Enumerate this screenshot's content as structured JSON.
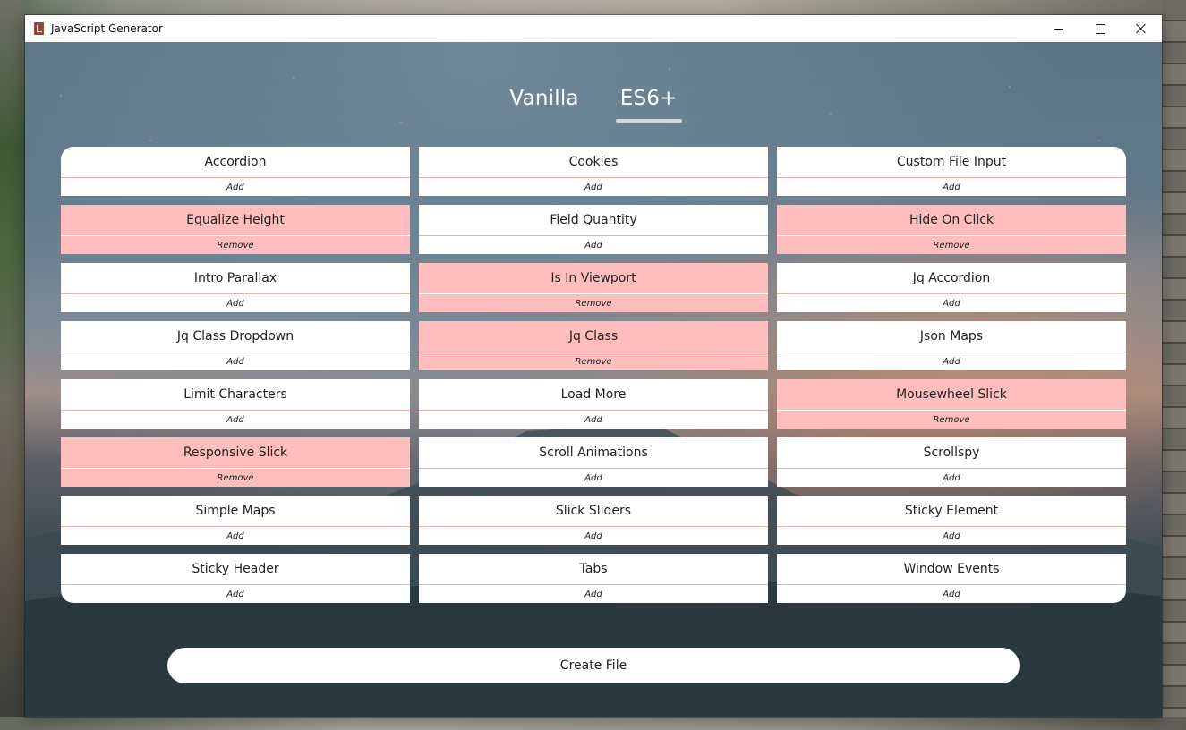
{
  "window": {
    "title": "JavaScript Generator"
  },
  "tabs": [
    {
      "label": "Vanilla",
      "active": false
    },
    {
      "label": "ES6+",
      "active": true
    }
  ],
  "modules": [
    {
      "name": "Accordion",
      "action": "Add",
      "selected": false
    },
    {
      "name": "Cookies",
      "action": "Add",
      "selected": false
    },
    {
      "name": "Custom File Input",
      "action": "Add",
      "selected": false
    },
    {
      "name": "Equalize Height",
      "action": "Remove",
      "selected": true
    },
    {
      "name": "Field Quantity",
      "action": "Add",
      "selected": false
    },
    {
      "name": "Hide On Click",
      "action": "Remove",
      "selected": true
    },
    {
      "name": "Intro Parallax",
      "action": "Add",
      "selected": false
    },
    {
      "name": "Is In Viewport",
      "action": "Remove",
      "selected": true
    },
    {
      "name": "Jq Accordion",
      "action": "Add",
      "selected": false
    },
    {
      "name": "Jq Class Dropdown",
      "action": "Add",
      "selected": false
    },
    {
      "name": "Jq Class",
      "action": "Remove",
      "selected": true
    },
    {
      "name": "Json Maps",
      "action": "Add",
      "selected": false
    },
    {
      "name": "Limit Characters",
      "action": "Add",
      "selected": false
    },
    {
      "name": "Load More",
      "action": "Add",
      "selected": false
    },
    {
      "name": "Mousewheel Slick",
      "action": "Remove",
      "selected": true
    },
    {
      "name": "Responsive Slick",
      "action": "Remove",
      "selected": true
    },
    {
      "name": "Scroll Animations",
      "action": "Add",
      "selected": false
    },
    {
      "name": "Scrollspy",
      "action": "Add",
      "selected": false
    },
    {
      "name": "Simple Maps",
      "action": "Add",
      "selected": false
    },
    {
      "name": "Slick Sliders",
      "action": "Add",
      "selected": false
    },
    {
      "name": "Sticky Element",
      "action": "Add",
      "selected": false
    },
    {
      "name": "Sticky Header",
      "action": "Add",
      "selected": false
    },
    {
      "name": "Tabs",
      "action": "Add",
      "selected": false
    },
    {
      "name": "Window Events",
      "action": "Add",
      "selected": false
    }
  ],
  "create_button": {
    "label": "Create File"
  },
  "colors": {
    "selected_card": "#ffbdbd",
    "card": "#ffffff",
    "divider": "#f1b0a8"
  }
}
